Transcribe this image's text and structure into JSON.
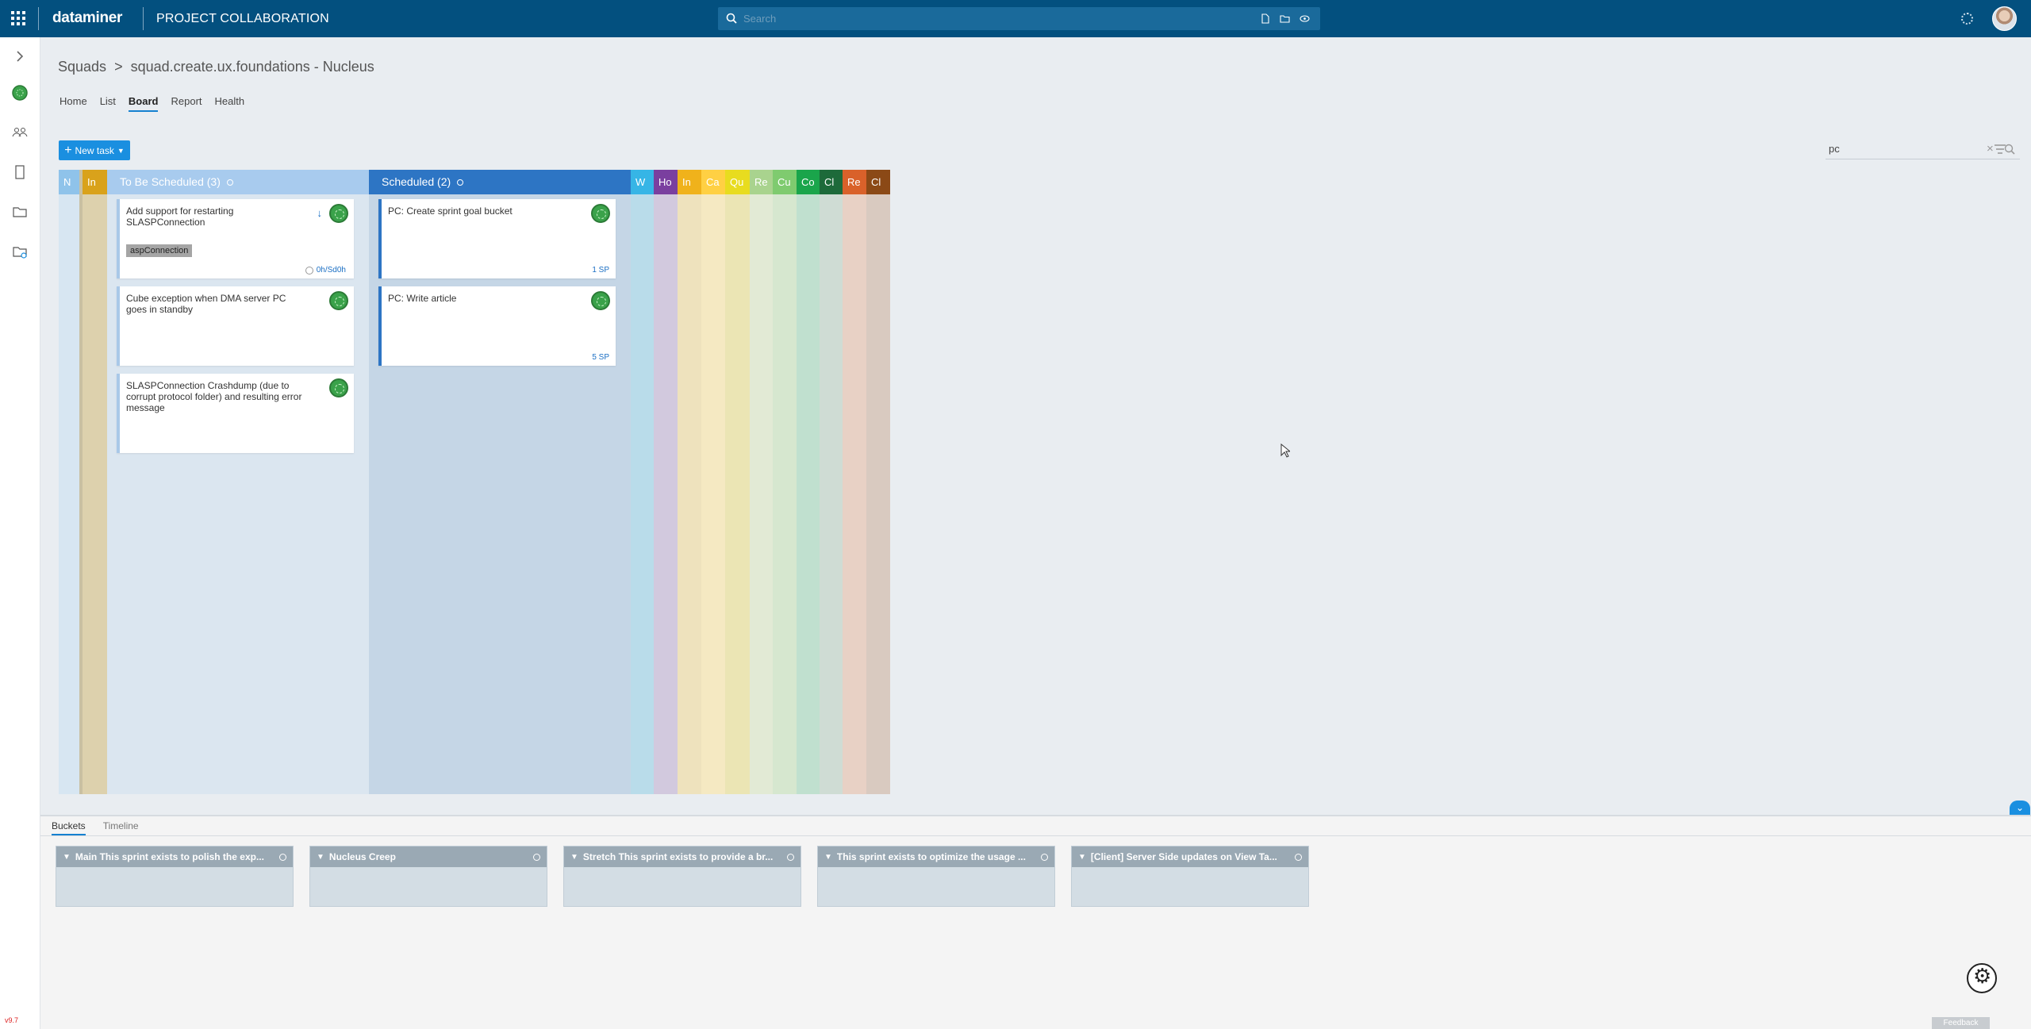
{
  "topbar": {
    "logo": "dataminer",
    "app_title": "PROJECT COLLABORATION",
    "search_placeholder": "Search"
  },
  "rail": {
    "icons": [
      "chevron-right-icon",
      "squad-avatar-icon",
      "people-icon",
      "document-icon",
      "folder-icon",
      "folder-sync-icon"
    ],
    "version": "v9.7"
  },
  "breadcrumb": {
    "root": "Squads",
    "separator": ">",
    "current": "squad.create.ux.foundations - Nucleus"
  },
  "tabs": [
    {
      "label": "Home",
      "active": false
    },
    {
      "label": "List",
      "active": false
    },
    {
      "label": "Board",
      "active": true
    },
    {
      "label": "Report",
      "active": false
    },
    {
      "label": "Health",
      "active": false
    }
  ],
  "new_task_label": "New task",
  "filter": {
    "value": "pc"
  },
  "board": {
    "narrow_left": [
      {
        "label": "N",
        "header": "#8fc3ea",
        "body": "#d7e6f2"
      },
      {
        "label": "In",
        "header": "#d9a21b",
        "body": "#ddd1ad"
      }
    ],
    "columns": [
      {
        "label": "To Be Scheduled (3)",
        "header": "#a8cbee",
        "body": "#dbe6f0",
        "cards": [
          {
            "title": "Add support for restarting SLASPConnection",
            "tag": "aspConnection",
            "meta": "0h/Sd0h",
            "priority": true,
            "style": "light"
          },
          {
            "title": "Cube exception when DMA server PC goes in standby",
            "style": "light"
          },
          {
            "title": "SLASPConnection Crashdump (due to corrupt protocol folder) and resulting error message",
            "style": "light"
          }
        ]
      },
      {
        "label": "Scheduled (2)",
        "header": "#2d75c4",
        "body": "#c5d6e6",
        "cards": [
          {
            "title": "PC: Create sprint goal bucket",
            "sp": "1 SP",
            "style": "blue"
          },
          {
            "title": "PC: Write article",
            "sp": "5 SP",
            "style": "blue"
          }
        ]
      }
    ],
    "narrow_right": [
      {
        "label": "W",
        "header": "#36b5e6",
        "body": "#b9dcea"
      },
      {
        "label": "Ho",
        "header": "#7a3f9f",
        "body": "#d2c9de"
      },
      {
        "label": "In",
        "header": "#f0b21b",
        "body": "#eee2bd"
      },
      {
        "label": "Ca",
        "header": "#ffd043",
        "body": "#f5e9c2"
      },
      {
        "label": "Qu",
        "header": "#e8dc1f",
        "body": "#ebe5b4"
      },
      {
        "label": "Re",
        "header": "#a9d38e",
        "body": "#e2ead5"
      },
      {
        "label": "Cu",
        "header": "#7fcb6f",
        "body": "#d6e7cf"
      },
      {
        "label": "Co",
        "header": "#1aa54b",
        "body": "#c0e0cf"
      },
      {
        "label": "Cl",
        "header": "#1d6a3a",
        "body": "#cfdcd4"
      },
      {
        "label": "Re",
        "header": "#d9612a",
        "body": "#e8d1c5"
      },
      {
        "label": "Cl",
        "header": "#8b4916",
        "body": "#d9cac0"
      }
    ]
  },
  "bottom": {
    "tabs": [
      {
        "label": "Buckets",
        "active": true
      },
      {
        "label": "Timeline",
        "active": false
      }
    ],
    "buckets": [
      {
        "title": "Main This sprint exists to polish the exp..."
      },
      {
        "title": "Nucleus Creep"
      },
      {
        "title": "Stretch This sprint exists to provide a br..."
      },
      {
        "title": "This sprint exists to optimize the usage ..."
      },
      {
        "title": "[Client] Server Side updates on View Ta..."
      }
    ],
    "feedback_label": "Feedback"
  }
}
